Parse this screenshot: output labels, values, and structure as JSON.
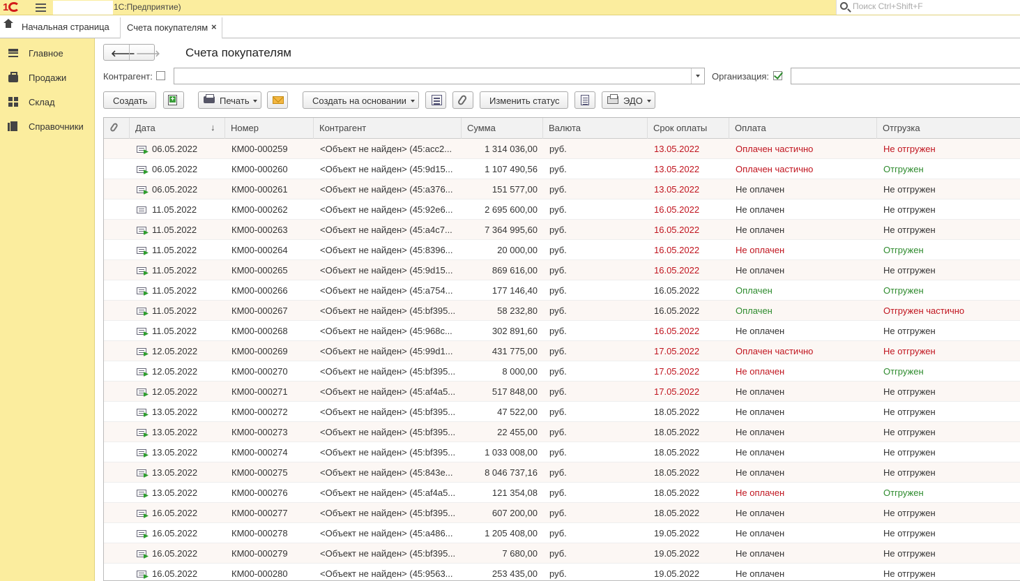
{
  "app": {
    "title": "1С:Предприятие)",
    "search_placeholder": "Поиск Ctrl+Shift+F"
  },
  "tabs": {
    "home_label": "Начальная страница",
    "active_label": "Счета покупателям",
    "close_symbol": "×"
  },
  "sidebar": {
    "items": [
      {
        "label": "Главное",
        "icon": "menu-icon"
      },
      {
        "label": "Продажи",
        "icon": "bag-icon"
      },
      {
        "label": "Склад",
        "icon": "grid-icon"
      },
      {
        "label": "Справочники",
        "icon": "books-icon"
      }
    ]
  },
  "form": {
    "title": "Счета покупателям",
    "back_symbol": "🡐",
    "forward_symbol": "🡒"
  },
  "filters": {
    "counterparty_label": "Контрагент:",
    "counterparty_checked": false,
    "counterparty_value": "",
    "organization_label": "Организация:",
    "organization_checked": true,
    "organization_value": ""
  },
  "toolbar": {
    "create_label": "Создать",
    "print_label": "Печать",
    "create_based_label": "Создать на основании",
    "change_status_label": "Изменить статус",
    "edo_label": "ЭДО"
  },
  "table": {
    "columns": {
      "date": "Дата",
      "number": "Номер",
      "counterparty": "Контрагент",
      "sum": "Сумма",
      "currency": "Валюта",
      "due": "Срок оплаты",
      "payment": "Оплата",
      "shipment": "Отгрузка"
    },
    "sort_symbol": "↓",
    "colors": {
      "red": "#c0141e",
      "green": "#2e8b2e",
      "normal": "#333333"
    },
    "rows": [
      {
        "posted": true,
        "date": "06.05.2022",
        "number": "КМ00-000259",
        "counterparty": "<Объект не найден> (45:acc2...",
        "sum": "1 314 036,00",
        "currency": "руб.",
        "due": "13.05.2022",
        "due_style": "red",
        "payment": "Оплачен частично",
        "payment_style": "red",
        "shipment": "Не отгружен",
        "shipment_style": "red"
      },
      {
        "posted": true,
        "date": "06.05.2022",
        "number": "КМ00-000260",
        "counterparty": "<Объект не найден> (45:9d15...",
        "sum": "1 107 490,56",
        "currency": "руб.",
        "due": "13.05.2022",
        "due_style": "red",
        "payment": "Оплачен частично",
        "payment_style": "red",
        "shipment": "Отгружен",
        "shipment_style": "green"
      },
      {
        "posted": true,
        "date": "06.05.2022",
        "number": "КМ00-000261",
        "counterparty": "<Объект не найден> (45:a376...",
        "sum": "151 577,00",
        "currency": "руб.",
        "due": "13.05.2022",
        "due_style": "red",
        "payment": "Не оплачен",
        "payment_style": "normal",
        "shipment": "Не отгружен",
        "shipment_style": "normal"
      },
      {
        "posted": false,
        "date": "11.05.2022",
        "number": "КМ00-000262",
        "counterparty": "<Объект не найден> (45:92e6...",
        "sum": "2 695 600,00",
        "currency": "руб.",
        "due": "16.05.2022",
        "due_style": "red",
        "payment": "Не оплачен",
        "payment_style": "normal",
        "shipment": "Не отгружен",
        "shipment_style": "normal"
      },
      {
        "posted": true,
        "date": "11.05.2022",
        "number": "КМ00-000263",
        "counterparty": "<Объект не найден> (45:a4c7...",
        "sum": "7 364 995,60",
        "currency": "руб.",
        "due": "16.05.2022",
        "due_style": "red",
        "payment": "Не оплачен",
        "payment_style": "normal",
        "shipment": "Не отгружен",
        "shipment_style": "normal"
      },
      {
        "posted": true,
        "date": "11.05.2022",
        "number": "КМ00-000264",
        "counterparty": "<Объект не найден> (45:8396...",
        "sum": "20 000,00",
        "currency": "руб.",
        "due": "16.05.2022",
        "due_style": "red",
        "payment": "Не оплачен",
        "payment_style": "red",
        "shipment": "Отгружен",
        "shipment_style": "green"
      },
      {
        "posted": true,
        "date": "11.05.2022",
        "number": "КМ00-000265",
        "counterparty": "<Объект не найден> (45:9d15...",
        "sum": "869 616,00",
        "currency": "руб.",
        "due": "16.05.2022",
        "due_style": "red",
        "payment": "Не оплачен",
        "payment_style": "normal",
        "shipment": "Не отгружен",
        "shipment_style": "normal"
      },
      {
        "posted": true,
        "date": "11.05.2022",
        "number": "КМ00-000266",
        "counterparty": "<Объект не найден> (45:a754...",
        "sum": "177 146,40",
        "currency": "руб.",
        "due": "16.05.2022",
        "due_style": "normal",
        "payment": "Оплачен",
        "payment_style": "green",
        "shipment": "Отгружен",
        "shipment_style": "green"
      },
      {
        "posted": true,
        "date": "11.05.2022",
        "number": "КМ00-000267",
        "counterparty": "<Объект не найден> (45:bf395...",
        "sum": "58 232,80",
        "currency": "руб.",
        "due": "16.05.2022",
        "due_style": "normal",
        "payment": "Оплачен",
        "payment_style": "green",
        "shipment": "Отгружен частично",
        "shipment_style": "red"
      },
      {
        "posted": true,
        "date": "11.05.2022",
        "number": "КМ00-000268",
        "counterparty": "<Объект не найден> (45:968c...",
        "sum": "302 891,60",
        "currency": "руб.",
        "due": "16.05.2022",
        "due_style": "red",
        "payment": "Не оплачен",
        "payment_style": "normal",
        "shipment": "Не отгружен",
        "shipment_style": "normal"
      },
      {
        "posted": true,
        "date": "12.05.2022",
        "number": "КМ00-000269",
        "counterparty": "<Объект не найден> (45:99d1...",
        "sum": "431 775,00",
        "currency": "руб.",
        "due": "17.05.2022",
        "due_style": "red",
        "payment": "Оплачен частично",
        "payment_style": "red",
        "shipment": "Не отгружен",
        "shipment_style": "red"
      },
      {
        "posted": true,
        "date": "12.05.2022",
        "number": "КМ00-000270",
        "counterparty": "<Объект не найден> (45:bf395...",
        "sum": "8 000,00",
        "currency": "руб.",
        "due": "17.05.2022",
        "due_style": "red",
        "payment": "Не оплачен",
        "payment_style": "red",
        "shipment": "Отгружен",
        "shipment_style": "green"
      },
      {
        "posted": true,
        "date": "12.05.2022",
        "number": "КМ00-000271",
        "counterparty": "<Объект не найден> (45:af4a5...",
        "sum": "517 848,00",
        "currency": "руб.",
        "due": "17.05.2022",
        "due_style": "red",
        "payment": "Не оплачен",
        "payment_style": "normal",
        "shipment": "Не отгружен",
        "shipment_style": "normal"
      },
      {
        "posted": true,
        "date": "13.05.2022",
        "number": "КМ00-000272",
        "counterparty": "<Объект не найден> (45:bf395...",
        "sum": "47 522,00",
        "currency": "руб.",
        "due": "18.05.2022",
        "due_style": "normal",
        "payment": "Не оплачен",
        "payment_style": "normal",
        "shipment": "Не отгружен",
        "shipment_style": "normal"
      },
      {
        "posted": true,
        "date": "13.05.2022",
        "number": "КМ00-000273",
        "counterparty": "<Объект не найден> (45:bf395...",
        "sum": "22 455,00",
        "currency": "руб.",
        "due": "18.05.2022",
        "due_style": "normal",
        "payment": "Не оплачен",
        "payment_style": "normal",
        "shipment": "Не отгружен",
        "shipment_style": "normal"
      },
      {
        "posted": true,
        "date": "13.05.2022",
        "number": "КМ00-000274",
        "counterparty": "<Объект не найден> (45:bf395...",
        "sum": "1 033 008,00",
        "currency": "руб.",
        "due": "18.05.2022",
        "due_style": "normal",
        "payment": "Не оплачен",
        "payment_style": "normal",
        "shipment": "Не отгружен",
        "shipment_style": "normal"
      },
      {
        "posted": true,
        "date": "13.05.2022",
        "number": "КМ00-000275",
        "counterparty": "<Объект не найден> (45:843e...",
        "sum": "8 046 737,16",
        "currency": "руб.",
        "due": "18.05.2022",
        "due_style": "normal",
        "payment": "Не оплачен",
        "payment_style": "normal",
        "shipment": "Не отгружен",
        "shipment_style": "normal"
      },
      {
        "posted": true,
        "date": "13.05.2022",
        "number": "КМ00-000276",
        "counterparty": "<Объект не найден> (45:af4a5...",
        "sum": "121 354,08",
        "currency": "руб.",
        "due": "18.05.2022",
        "due_style": "normal",
        "payment": "Не оплачен",
        "payment_style": "red",
        "shipment": "Отгружен",
        "shipment_style": "green"
      },
      {
        "posted": true,
        "date": "16.05.2022",
        "number": "КМ00-000277",
        "counterparty": "<Объект не найден> (45:bf395...",
        "sum": "607 200,00",
        "currency": "руб.",
        "due": "18.05.2022",
        "due_style": "normal",
        "payment": "Не оплачен",
        "payment_style": "normal",
        "shipment": "Не отгружен",
        "shipment_style": "normal"
      },
      {
        "posted": true,
        "date": "16.05.2022",
        "number": "КМ00-000278",
        "counterparty": "<Объект не найден> (45:a486...",
        "sum": "1 205 408,00",
        "currency": "руб.",
        "due": "19.05.2022",
        "due_style": "normal",
        "payment": "Не оплачен",
        "payment_style": "normal",
        "shipment": "Не отгружен",
        "shipment_style": "normal"
      },
      {
        "posted": true,
        "date": "16.05.2022",
        "number": "КМ00-000279",
        "counterparty": "<Объект не найден> (45:bf395...",
        "sum": "7 680,00",
        "currency": "руб.",
        "due": "19.05.2022",
        "due_style": "normal",
        "payment": "Не оплачен",
        "payment_style": "normal",
        "shipment": "Не отгружен",
        "shipment_style": "normal"
      },
      {
        "posted": true,
        "date": "16.05.2022",
        "number": "КМ00-000280",
        "counterparty": "<Объект не найден> (45:9563...",
        "sum": "253 435,00",
        "currency": "руб.",
        "due": "19.05.2022",
        "due_style": "normal",
        "payment": "Не оплачен",
        "payment_style": "normal",
        "shipment": "Не отгружен",
        "shipment_style": "normal"
      }
    ]
  }
}
